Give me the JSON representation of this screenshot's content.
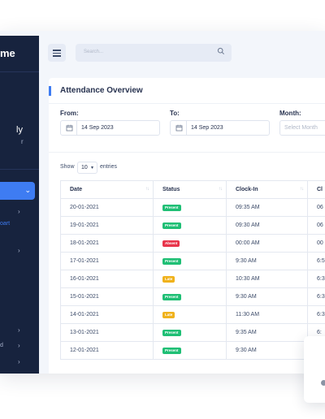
{
  "sidebar": {
    "brand": "me",
    "user_name": "ly",
    "user_role": "r",
    "active_chevron": "⌄",
    "sub_item": "oart",
    "bottom_text": "d",
    "icons": [
      "chevron-right-icon",
      "chevron-down-icon"
    ]
  },
  "header": {
    "search_placeholder": "Search..."
  },
  "card": {
    "title": "Attendance Overview",
    "from_label": "From:",
    "from_value": "14 Sep 2023",
    "to_label": "To:",
    "to_value": "14 Sep 2023",
    "month_label": "Month:",
    "month_placeholder": "Select Month"
  },
  "table_controls": {
    "show_label": "Show",
    "page_size": "10",
    "entries_label": "entries"
  },
  "table": {
    "headers": [
      "Date",
      "Status",
      "Clock-In",
      "Cl"
    ],
    "rows": [
      {
        "date": "20-01-2021",
        "status": "Present",
        "clock_in": "09:35 AM",
        "clock_out": "06"
      },
      {
        "date": "19-01-2021",
        "status": "Present",
        "clock_in": "09:30 AM",
        "clock_out": "06"
      },
      {
        "date": "18-01-2021",
        "status": "Absent",
        "clock_in": "00:00 AM",
        "clock_out": "00"
      },
      {
        "date": "17-01-2021",
        "status": "Present",
        "clock_in": "9:30 AM",
        "clock_out": "6:5"
      },
      {
        "date": "16-01-2021",
        "status": "Late",
        "clock_in": "10:30 AM",
        "clock_out": "6:3"
      },
      {
        "date": "15-01-2021",
        "status": "Present",
        "clock_in": "9:30 AM",
        "clock_out": "6:3"
      },
      {
        "date": "14-01-2021",
        "status": "Late",
        "clock_in": "11:30 AM",
        "clock_out": "6:3"
      },
      {
        "date": "13-01-2021",
        "status": "Present",
        "clock_in": "9:35 AM",
        "clock_out": "6:"
      },
      {
        "date": "12-01-2021",
        "status": "Present",
        "clock_in": "9:30 AM",
        "clock_out": "6:3"
      }
    ]
  },
  "colors": {
    "sidebar_bg": "#17233e",
    "accent": "#3e7cf2",
    "present": "#1fbf75",
    "absent": "#e8354b",
    "late": "#f0b21c"
  }
}
